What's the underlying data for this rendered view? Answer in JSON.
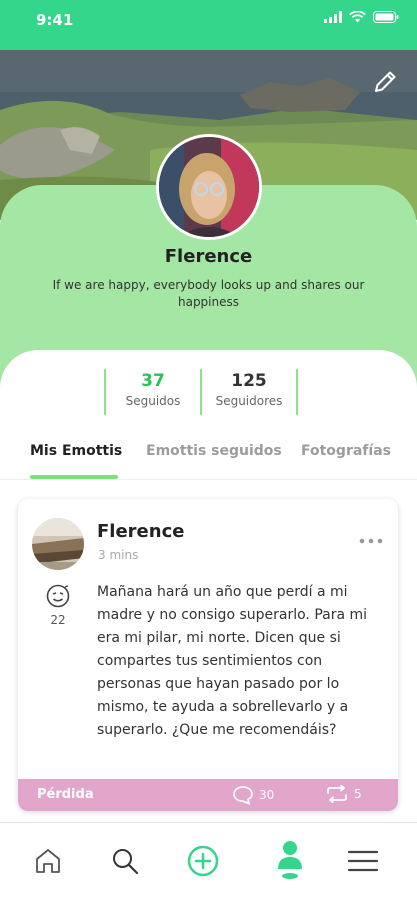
{
  "status_bar": {
    "time": "9:41"
  },
  "profile": {
    "name": "Flerence",
    "bio": "If we are happy, everybody looks up and shares our happiness"
  },
  "stats": [
    {
      "value": "37",
      "label": "Seguidos"
    },
    {
      "value": "125",
      "label": "Seguidores"
    }
  ],
  "tabs": [
    {
      "label": "Mis Emottis",
      "active": true
    },
    {
      "label": "Emottis seguidos",
      "active": false
    },
    {
      "label": "Fotografías",
      "active": false
    }
  ],
  "post": {
    "author": "Flerence",
    "time": "3 mins",
    "emoji_count": "22",
    "text": "Mañana hará un año que perdí a mi madre y no consigo superarlo. Para mi era mi pilar, mi norte. Dicen que si compartes tus sentimientos con personas que hayan pasado por lo mismo, te ayuda a sobrellevarlo y a superarlo. ¿Que me recomendáis?",
    "tag": "Pérdida",
    "comments": "30",
    "reposts": "5"
  },
  "icons": {
    "edit": "pencil-icon",
    "more": "more-dots-icon",
    "emotion": "emoji-face-icon",
    "comment": "comment-icon",
    "repost": "repost-icon",
    "nav": [
      "home-icon",
      "search-icon",
      "add-circle-icon",
      "profile-icon",
      "menu-icon"
    ]
  },
  "colors": {
    "accent_green": "#33d68a",
    "profile_panel": "#a4e6a4",
    "stat_green": "#2fbf5a",
    "tag_pink": "#e1a6c9"
  }
}
